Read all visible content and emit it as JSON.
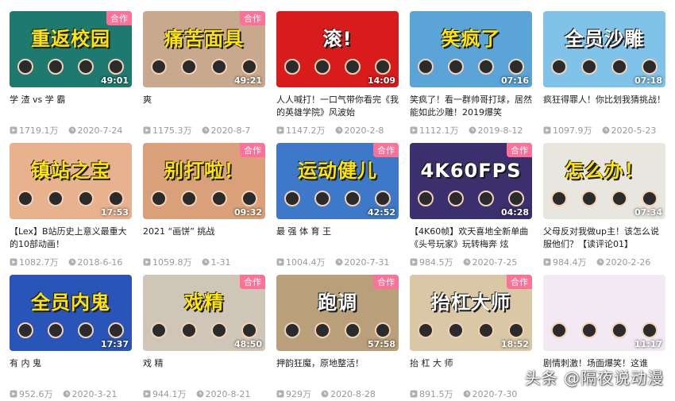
{
  "colors": {
    "badge": "#fb7299",
    "meta": "#999999",
    "title": "#212121"
  },
  "videos": [
    {
      "thumb_text": "重返校园",
      "badge": "合作",
      "duration": "49:01",
      "title": "学 渣 vs 学 霸",
      "views": "1719.1万",
      "date": "2020-7-24",
      "bg": "#1e7a6f",
      "fg": "#ffe600"
    },
    {
      "thumb_text": "痛苦面具",
      "badge": "合作",
      "duration": "49:21",
      "title": "爽",
      "views": "1175.3万",
      "date": "2020-8-7",
      "bg": "#c9a98e",
      "fg": "#ffe600"
    },
    {
      "thumb_text": "滚!",
      "badge": "",
      "duration": "14:09",
      "title": "人人喊打！一口气带你看完《我的英雄学院》风波始",
      "views": "1147.2万",
      "date": "2020-2-8",
      "bg": "#d81b1b",
      "fg": "#ffffff"
    },
    {
      "thumb_text": "笑疯了",
      "badge": "",
      "duration": "07:16",
      "title": "笑疯了！看一群帅哥打球，居然能如此沙雕！2019爆笑",
      "views": "1112.1万",
      "date": "2019-8-12",
      "bg": "#5aa4d8",
      "fg": "#ffe600"
    },
    {
      "thumb_text": "全员沙雕",
      "badge": "",
      "duration": "07:18",
      "title": "疯狂得罪人！你比划我猜挑战！",
      "views": "1097.9万",
      "date": "2020-5-23",
      "bg": "#7fc3e8",
      "fg": "#ffffff"
    },
    {
      "thumb_text": "镇站之宝",
      "badge": "",
      "duration": "17:53",
      "title": "【Lex】B站历史上意义最重大的10部动画！",
      "views": "1082.7万",
      "date": "2018-6-16",
      "bg": "#e9b28f",
      "fg": "#ffe600"
    },
    {
      "thumb_text": "别打啦！",
      "badge": "合作",
      "duration": "09:32",
      "title": "2021 “画饼” 挑战",
      "views": "1059.8万",
      "date": "1-31",
      "bg": "#d9a07a",
      "fg": "#ffe600"
    },
    {
      "thumb_text": "运动健儿",
      "badge": "合作",
      "duration": "42:52",
      "title": "最 强 体 育 王",
      "views": "1004.4万",
      "date": "2020-7-31",
      "bg": "#3e78c9",
      "fg": "#ffe600"
    },
    {
      "thumb_text": "4K60FPS",
      "badge": "合作",
      "duration": "04:28",
      "title": "【4K60帧】欢天喜地全新单曲《头号玩家》玩转梅奔 炫",
      "views": "984.5万",
      "date": "2020-7-25",
      "bg": "#3b2f6e",
      "fg": "#ffffff"
    },
    {
      "thumb_text": "怎么办！",
      "badge": "",
      "duration": "07:34",
      "title": "父母反对我做up主！该怎么说服他们？【读评论01】",
      "views": "984.4万",
      "date": "2020-2-26",
      "bg": "#e9e5df",
      "fg": "#ffe600"
    },
    {
      "thumb_text": "全员内鬼",
      "badge": "",
      "duration": "17:37",
      "title": "有 内 鬼",
      "views": "952.6万",
      "date": "2020-3-21",
      "bg": "#2a55b8",
      "fg": "#ffe600"
    },
    {
      "thumb_text": "戏精",
      "badge": "合作",
      "duration": "48:50",
      "title": "戏 精",
      "views": "944.1万",
      "date": "2020-8-21",
      "bg": "#cfc6b8",
      "fg": "#ffe600"
    },
    {
      "thumb_text": "跑调",
      "badge": "合作",
      "duration": "57:58",
      "title": "押韵狂魔，原地整活！",
      "views": "929万",
      "date": "2020-8-28",
      "bg": "#b9a07a",
      "fg": "#ffffff"
    },
    {
      "thumb_text": "抬杠大师",
      "badge": "合作",
      "duration": "18:52",
      "title": "抬 杠 大 师",
      "views": "891.5万",
      "date": "2020-7-30",
      "bg": "#d9c7a5",
      "fg": "#ffffff"
    },
    {
      "thumb_text": "",
      "badge": "",
      "duration": "11:17",
      "title": "剧情刺激！场面爆笑！这谁",
      "views": "",
      "date": "",
      "bg": "#f2e9f3",
      "fg": "#ffe600"
    }
  ],
  "watermark": "头条 @隔夜说动漫"
}
